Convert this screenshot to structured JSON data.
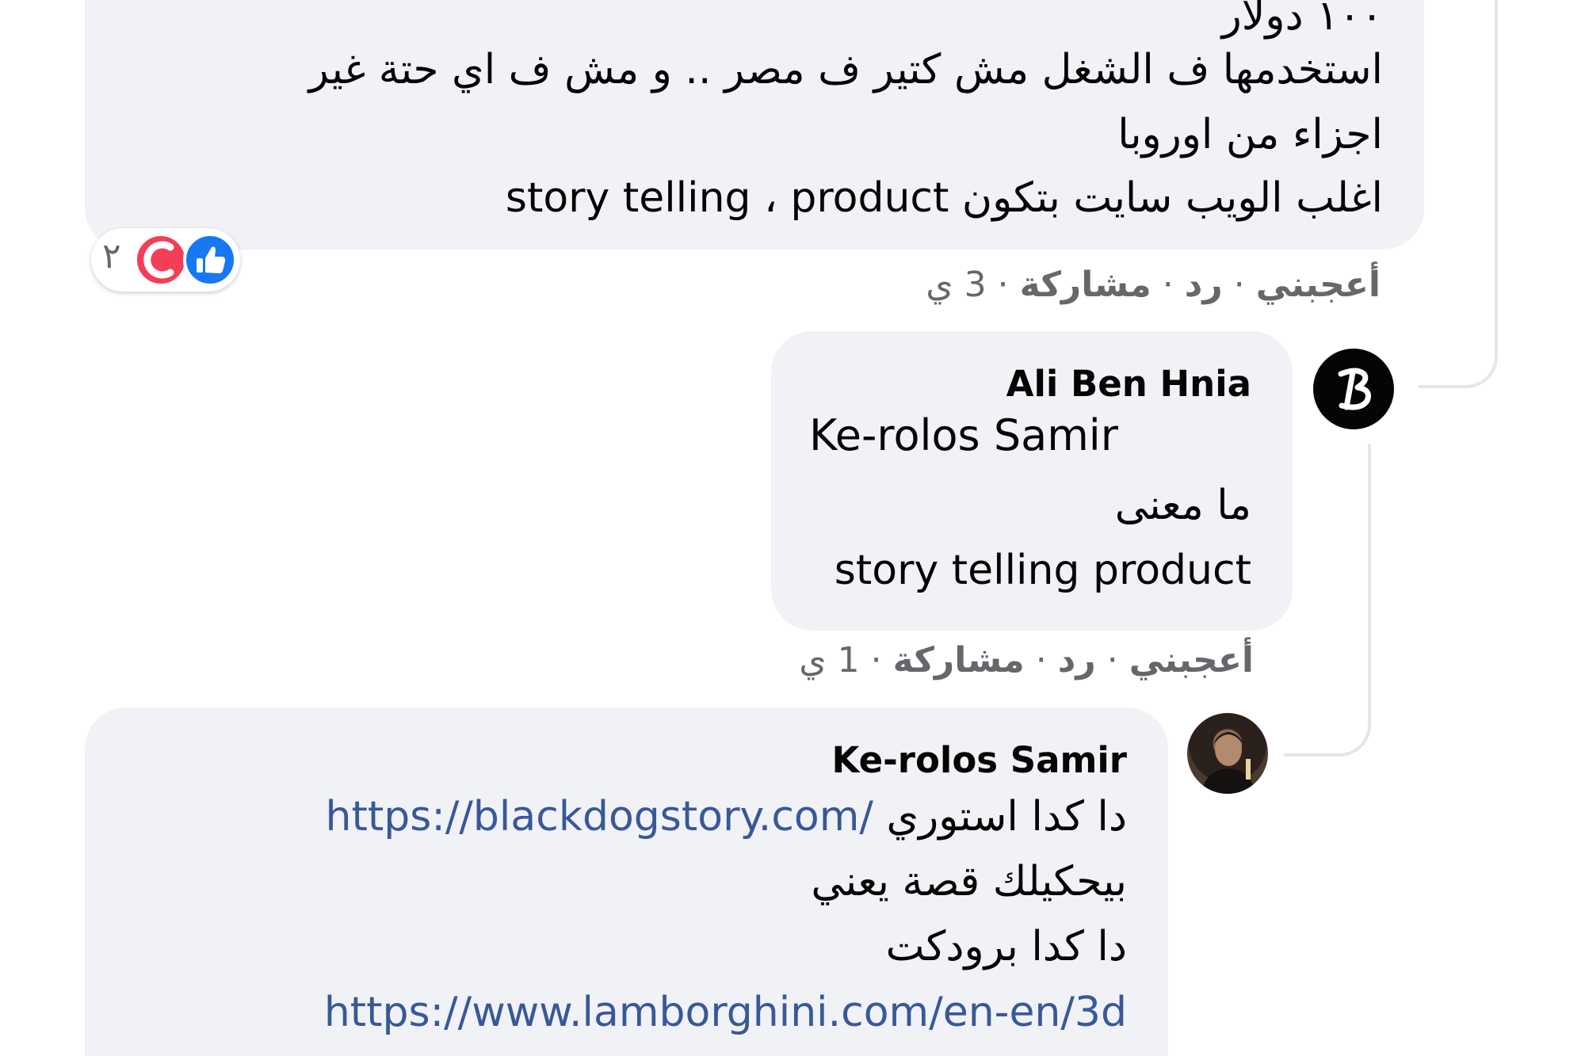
{
  "comment1": {
    "lines": [
      "١٠٠ دولار",
      "استخدمها ف الشغل مش كتير ف مصر .. و مش ف اي حتة غير",
      "اجزاء من اوروبا",
      "اغلب الويب سايت بتكون story telling ، product"
    ],
    "reactions": {
      "icons": [
        "like-icon",
        "care-icon"
      ],
      "count": "٢",
      "colors": {
        "like": "#1877f2",
        "care": "#f33e58"
      }
    },
    "actions": {
      "like": "أعجبني",
      "reply": "رد",
      "share": "مشاركة",
      "time": "3 ي",
      "separator": "·"
    }
  },
  "comment2": {
    "author": "Ali Ben Hnia",
    "mention": "Ke-rolos Samir",
    "lines": [
      "ما معنى",
      "story telling product"
    ],
    "avatar_icon": "letter-b-avatar-icon",
    "actions": {
      "like": "أعجبني",
      "reply": "رد",
      "share": "مشاركة",
      "time": "1 ي",
      "separator": "·"
    }
  },
  "comment3": {
    "author": "Ke-rolos Samir",
    "line1_text": "دا كدا استوري",
    "line1_link": "https://blackdogstory.com/",
    "line2": "بيحكيلك قصة يعني",
    "line3": "دا كدا برودكت",
    "line4_link": "https://www.lamborghini.com/en-en/3d",
    "avatar_icon": "profile-photo-avatar"
  },
  "colors": {
    "bubble_bg": "#f0f2f5",
    "link": "#385898",
    "meta_text": "#65676b"
  }
}
